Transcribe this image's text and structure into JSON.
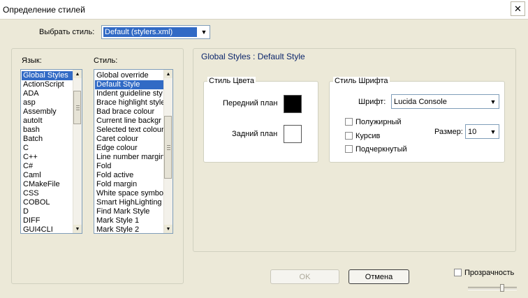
{
  "window": {
    "title": "Определение стилей"
  },
  "select_style": {
    "label": "Выбрать стиль:",
    "value": "Default (stylers.xml)"
  },
  "language": {
    "header": "Язык:",
    "items": [
      "Global Styles",
      "ActionScript",
      "ADA",
      "asp",
      "Assembly",
      "autoIt",
      "bash",
      "Batch",
      "C",
      "C++",
      "C#",
      "Caml",
      "CMakeFile",
      "CSS",
      "COBOL",
      "D",
      "DIFF",
      "GUI4CLI"
    ],
    "selected_index": 0
  },
  "style": {
    "header": "Стиль:",
    "items": [
      "Global override",
      "Default Style",
      "Indent guideline sty",
      "Brace highlight style",
      "Bad brace colour",
      "Current line backgr",
      "Selected text colour",
      "Caret colour",
      "Edge colour",
      "Line number margin",
      "Fold",
      "Fold active",
      "Fold margin",
      "White space symbo",
      "Smart HighLighting",
      "Find Mark Style",
      "Mark Style 1",
      "Mark Style 2"
    ],
    "selected_index": 1
  },
  "details": {
    "heading": "Global Styles : Default Style",
    "color_group": {
      "title": "Стиль Цвета",
      "foreground_label": "Передний план",
      "foreground_color": "#000000",
      "background_label": "Задний план",
      "background_color": "#ffffff"
    },
    "font_group": {
      "title": "Стиль Шрифта",
      "font_label": "Шрифт:",
      "font_value": "Lucida Console",
      "bold_label": "Полужирный",
      "italic_label": "Курсив",
      "underline_label": "Подчеркнутый",
      "size_label": "Размер:",
      "size_value": "10"
    }
  },
  "buttons": {
    "ok": "OK",
    "cancel": "Отмена"
  },
  "transparency": {
    "label": "Прозрачность",
    "checked": false,
    "level": 0.72
  },
  "colors": {
    "selection": "#316ac5",
    "heading": "#0a246a"
  }
}
